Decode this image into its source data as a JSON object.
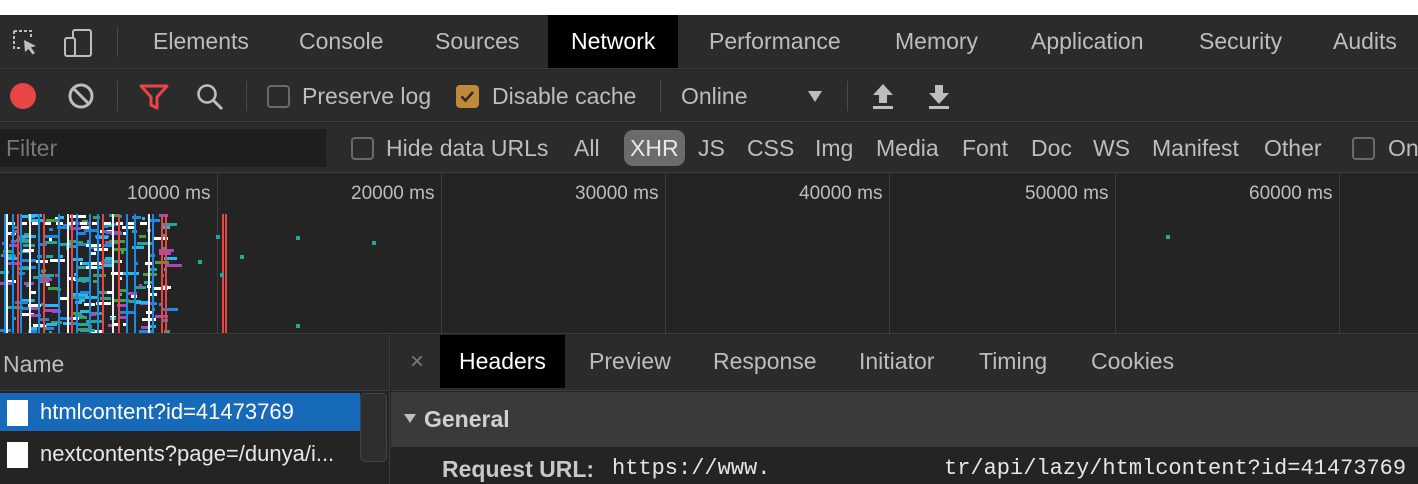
{
  "main_tabs": [
    {
      "label": "Elements"
    },
    {
      "label": "Console"
    },
    {
      "label": "Sources"
    },
    {
      "label": "Network",
      "active": true
    },
    {
      "label": "Performance"
    },
    {
      "label": "Memory"
    },
    {
      "label": "Application"
    },
    {
      "label": "Security"
    },
    {
      "label": "Audits"
    }
  ],
  "toolbar": {
    "preserve_log_label": "Preserve log",
    "preserve_log_checked": false,
    "disable_cache_label": "Disable cache",
    "disable_cache_checked": true,
    "throttling_value": "Online"
  },
  "filter_bar": {
    "placeholder": "Filter",
    "hide_data_urls_label": "Hide data URLs",
    "types": [
      "All",
      "XHR",
      "JS",
      "CSS",
      "Img",
      "Media",
      "Font",
      "Doc",
      "WS",
      "Manifest",
      "Other"
    ],
    "active_type": "XHR",
    "trailing_label": "On"
  },
  "overview": {
    "ticks": [
      "10000 ms",
      "20000 ms",
      "30000 ms",
      "40000 ms",
      "50000 ms",
      "60000 ms"
    ]
  },
  "requests": {
    "header": "Name",
    "items": [
      {
        "name": "htmlcontent?id=41473769",
        "selected": true
      },
      {
        "name": "nextcontents?page=/dunya/i..."
      }
    ]
  },
  "details": {
    "close_glyph": "×",
    "tabs": [
      "Headers",
      "Preview",
      "Response",
      "Initiator",
      "Timing",
      "Cookies"
    ],
    "active_tab": "Headers",
    "section_title": "General",
    "request_url_label": "Request URL:",
    "request_url_part1": "https://www.",
    "request_url_part2": "tr/api/lazy/htmlcontent?id=41473769"
  },
  "colors": {
    "record_red": "#e84545",
    "filter_red": "#e84545",
    "checkbox_accent": "#c08a3a",
    "selection_blue": "#1769b9",
    "active_tab_bg": "#000000"
  },
  "icons": [
    "inspect-element-icon",
    "device-toolbar-icon",
    "record-icon",
    "clear-icon",
    "filter-icon",
    "search-icon",
    "dropdown-arrow-icon",
    "import-har-icon",
    "export-har-icon",
    "document-icon",
    "disclosure-triangle-icon"
  ]
}
